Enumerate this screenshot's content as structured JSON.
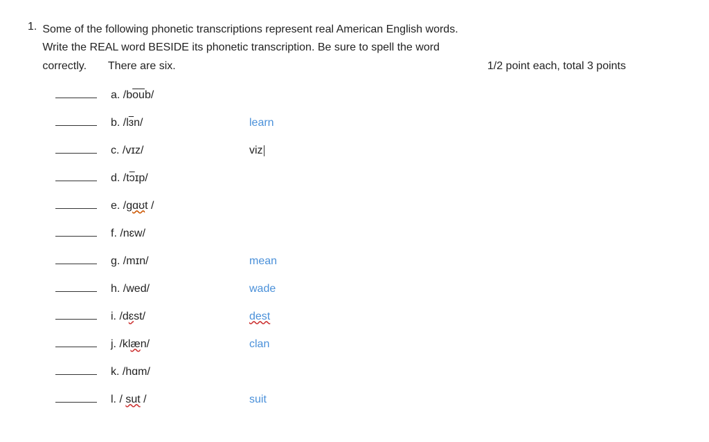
{
  "question": {
    "number": "1.",
    "text_line1": "Some of the following phonetic transcriptions represent real American English words.",
    "text_line2": "Write the REAL word BESIDE its phonetic transcription. Be sure to spell the word",
    "text_line3_left": "correctly.",
    "text_line3_center": "There are six.",
    "text_line3_right": "1/2 point each, total 3 points"
  },
  "items": [
    {
      "id": "a",
      "label": "a. /bōub/",
      "answer": "",
      "answer_style": "plain"
    },
    {
      "id": "b",
      "label": "b. /ləˈn/",
      "answer": "learn",
      "answer_style": "plain"
    },
    {
      "id": "c",
      "label": "c. /vɪz/",
      "answer": "viz",
      "answer_style": "cursor"
    },
    {
      "id": "d",
      "label": "d. /tɔɪp/",
      "answer": "",
      "answer_style": "plain"
    },
    {
      "id": "e",
      "label": "e. /gɑʊt /",
      "answer": "",
      "answer_style": "plain"
    },
    {
      "id": "f",
      "label": "f. /nɛw/",
      "answer": "",
      "answer_style": "plain"
    },
    {
      "id": "g",
      "label": "g. /mɪn/",
      "answer": "mean",
      "answer_style": "plain"
    },
    {
      "id": "h",
      "label": "h. /wed/",
      "answer": "wade",
      "answer_style": "plain"
    },
    {
      "id": "i",
      "label": "i. /dɛst/",
      "answer": "dest",
      "answer_style": "red-wavy"
    },
    {
      "id": "j",
      "label": "j. /klæn/",
      "answer": "clan",
      "answer_style": "plain"
    },
    {
      "id": "k",
      "label": "k. /hɑm/",
      "answer": "",
      "answer_style": "plain"
    },
    {
      "id": "l",
      "label": "l. / sut /",
      "answer": "suit",
      "answer_style": "plain"
    }
  ],
  "colors": {
    "blue": "#4a90d9",
    "red_wavy": "#cc3333",
    "orange_wavy": "#cc5500",
    "text": "#222222"
  }
}
